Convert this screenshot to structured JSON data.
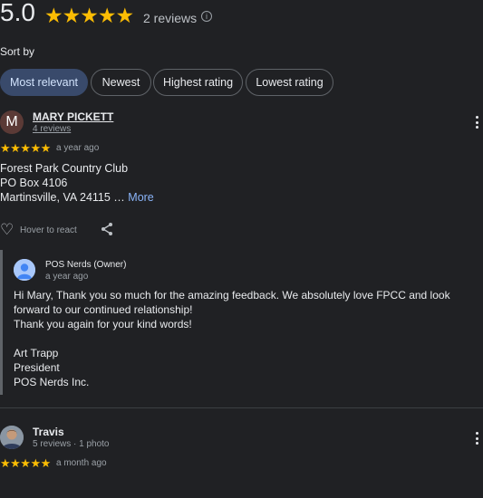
{
  "summary": {
    "rating": "5.0",
    "stars": "★★★★★",
    "review_count": "2 reviews",
    "info_icon": "info-icon"
  },
  "sort": {
    "label": "Sort by",
    "options": [
      "Most relevant",
      "Newest",
      "Highest rating",
      "Lowest rating"
    ],
    "selected": "Most relevant"
  },
  "reviews": [
    {
      "avatar_letter": "M",
      "name": "MARY PICKETT",
      "meta": "4 reviews",
      "stars": "★★★★★",
      "rating": 5,
      "time": "a year ago",
      "lines": [
        "Forest Park Country Club",
        "PO Box 4106",
        "Martinsville, VA 24115 …"
      ],
      "more_label": "More",
      "react_label": "Hover to react",
      "owner_reply": {
        "name": "POS Nerds (Owner)",
        "time": "a year ago",
        "lines": [
          "Hi Mary, Thank you so much for the amazing feedback. We absolutely love FPCC and look forward to our continued relationship!",
          "Thank you again for your kind words!",
          "",
          "Art Trapp",
          "President",
          "POS Nerds Inc."
        ]
      }
    },
    {
      "name": "Travis",
      "meta": "5 reviews · 1 photo",
      "stars": "★★★★★",
      "rating": 5,
      "time": "a month ago"
    }
  ],
  "colors": {
    "background": "#202124",
    "star": "#fbbc04",
    "link": "#8ab4f8",
    "chip_active": "#394a6b"
  }
}
